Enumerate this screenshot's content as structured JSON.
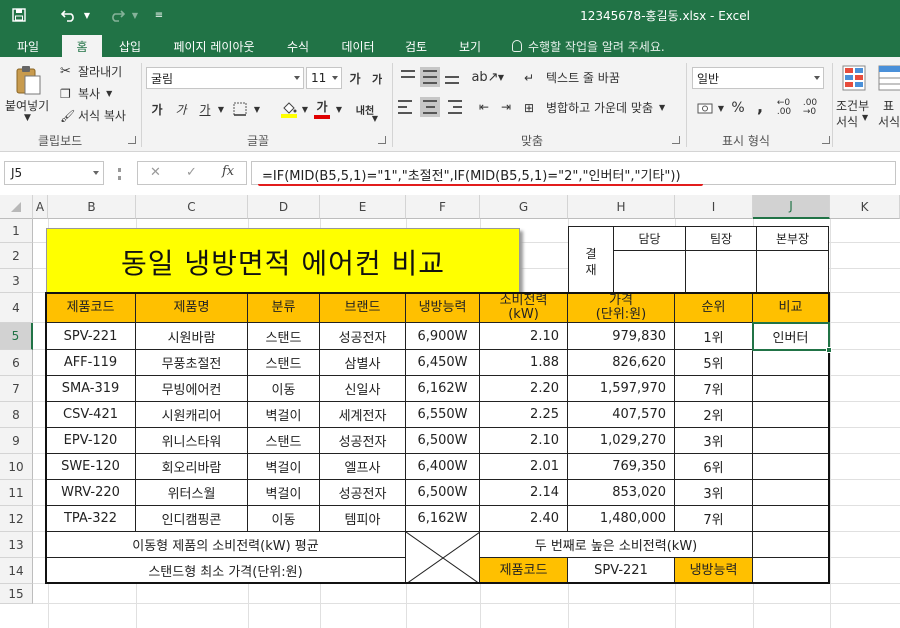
{
  "titlebar": {
    "filename": "12345678-홍길동.xlsx - Excel",
    "save_icon": "save-icon",
    "undo_icon": "undo-icon",
    "redo_icon": "redo-icon"
  },
  "tabs": [
    "파일",
    "홈",
    "삽입",
    "페이지 레이아웃",
    "수식",
    "데이터",
    "검토",
    "보기"
  ],
  "tell_me": "수행할 작업을 알려 주세요.",
  "ribbon": {
    "clipboard": {
      "paste": "붙여넣기",
      "cut": "잘라내기",
      "copy": "복사",
      "format_painter": "서식 복사",
      "label": "클립보드"
    },
    "font": {
      "name": "굴림",
      "size": "11",
      "grow": "가",
      "shrink": "가",
      "bold": "가",
      "italic": "가",
      "underline": "가",
      "label": "글꼴",
      "ext": "내천"
    },
    "alignment": {
      "wrap": "텍스트 줄 바꿈",
      "merge": "병합하고 가운데 맞춤",
      "label": "맞춤"
    },
    "number": {
      "format": "일반",
      "percent": "%",
      "comma": ",",
      "label": "표시 형식"
    },
    "styles": {
      "conditional": "조건부",
      "conditional2": "서식",
      "table": "표",
      "table2": "서식"
    }
  },
  "formula_bar": {
    "name_box": "J5",
    "formula": "=IF(MID(B5,5,1)=\"1\",\"초절전\",IF(MID(B5,5,1)=\"2\",\"인버터\",\"기타\"))"
  },
  "columns": [
    "A",
    "B",
    "C",
    "D",
    "E",
    "F",
    "G",
    "H",
    "I",
    "J",
    "K"
  ],
  "rows": [
    "1",
    "2",
    "3",
    "4",
    "5",
    "6",
    "7",
    "8",
    "9",
    "10",
    "11",
    "12",
    "13",
    "14",
    "15"
  ],
  "banner_title": "동일 냉방면적 에어컨 비교",
  "approval": {
    "label1": "결",
    "label2": "재",
    "roles": [
      "담당",
      "팀장",
      "본부장"
    ]
  },
  "table": {
    "headers": [
      "제품코드",
      "제품명",
      "분류",
      "브랜드",
      "냉방능력",
      "소비전력",
      "(kW)",
      "가격",
      "(단위:원)",
      "순위",
      "비교"
    ],
    "rows": [
      [
        "SPV-221",
        "시원바람",
        "스탠드",
        "성공전자",
        "6,900W",
        "2.10",
        "979,830",
        "1위",
        "인버터"
      ],
      [
        "AFF-119",
        "무풍초절전",
        "스탠드",
        "삼별사",
        "6,450W",
        "1.88",
        "826,620",
        "5위",
        ""
      ],
      [
        "SMA-319",
        "무빙에어컨",
        "이동",
        "신일사",
        "6,162W",
        "2.20",
        "1,597,970",
        "7위",
        ""
      ],
      [
        "CSV-421",
        "시원캐리어",
        "벽걸이",
        "세계전자",
        "6,550W",
        "2.25",
        "407,570",
        "2위",
        ""
      ],
      [
        "EPV-120",
        "위니스타워",
        "스탠드",
        "성공전자",
        "6,500W",
        "2.10",
        "1,029,270",
        "3위",
        ""
      ],
      [
        "SWE-120",
        "회오리바람",
        "벽걸이",
        "엘프사",
        "6,400W",
        "2.01",
        "769,350",
        "6위",
        ""
      ],
      [
        "WRV-220",
        "위터스월",
        "벽걸이",
        "성공전자",
        "6,500W",
        "2.14",
        "853,020",
        "3위",
        ""
      ],
      [
        "TPA-322",
        "인디캠핑콘",
        "이동",
        "템피아",
        "6,162W",
        "2.40",
        "1,480,000",
        "7위",
        ""
      ]
    ],
    "summary": {
      "r13_label": "이동형 제품의 소비전력(kW) 평균",
      "r14_label": "스탠드형 최소 가격(단위:원)",
      "r13_right": "두 번째로 높은 소비전력(kW)",
      "r14_code_label": "제품코드",
      "r14_code_value": "SPV-221",
      "r14_cool_label": "냉방능력"
    }
  }
}
